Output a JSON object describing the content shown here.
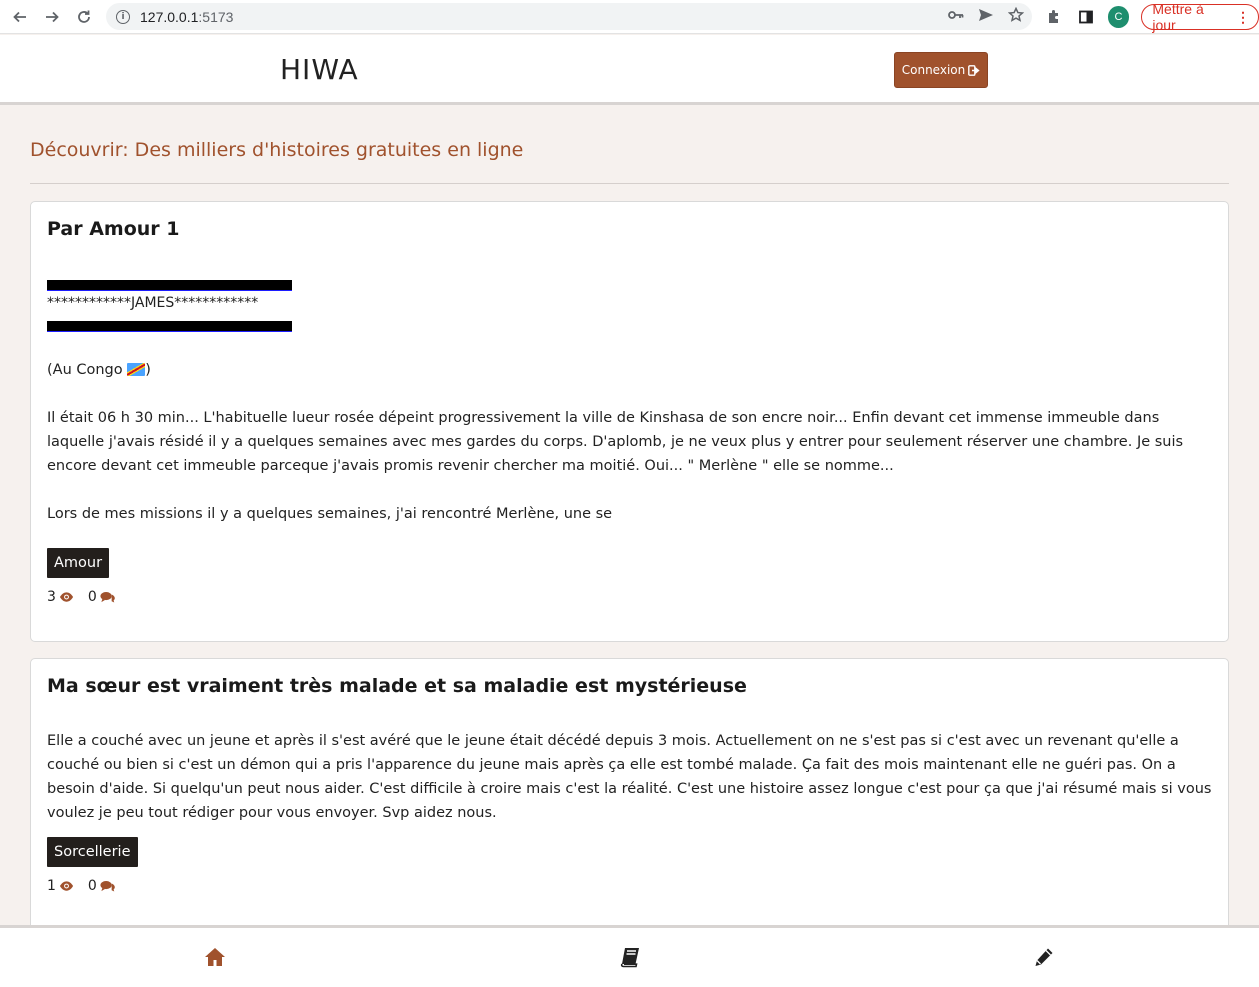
{
  "browser": {
    "url_host": "127.0.0.1",
    "url_port": ":5173",
    "profile_initial": "C",
    "update_label": "Mettre à jour"
  },
  "header": {
    "brand": "HIWA",
    "login_label": "Connexion"
  },
  "main": {
    "heading": "Découvrir: Des milliers d'histoires gratuites en ligne"
  },
  "stories": [
    {
      "title": "Par Amour 1",
      "stars_line": "************JAMES************",
      "location": "(Au Congo",
      "location_close": ")",
      "paragraph1": "Il était 06 h 30 min... L'habituelle lueur rosée dépeint progressivement la ville de Kinshasa de son encre noir... Enfin devant cet immense immeuble dans laquelle j'avais résidé il y a quelques semaines avec mes gardes du corps. D'aplomb, je ne veux plus y entrer pour seulement réserver une chambre. Je suis encore devant cet immeuble parceque j'avais promis revenir chercher ma moitié. Oui... \" Merlène \" elle se nomme...",
      "paragraph2": "Lors de mes missions il y a quelques semaines, j'ai rencontré Merlène, une se",
      "tag": "Amour",
      "views": "3",
      "comments": "0"
    },
    {
      "title": "Ma sœur est vraiment très malade et sa maladie est mystérieuse",
      "paragraph1": "Elle a couché avec un jeune et après il s'est avéré que le jeune était décédé depuis 3 mois. Actuellement on ne s'est pas si c'est avec un revenant qu'elle a couché ou bien si c'est un démon qui a pris l'apparence du jeune mais après ça elle est tombé malade. Ça fait des mois maintenant elle ne guéri pas. On a besoin d'aide. Si quelqu'un peut nous aider. C'est difficile à croire mais c'est la réalité. C'est une histoire assez longue c'est pour ça que j'ai résumé mais si vous voulez je peu tout rédiger pour vous envoyer. Svp aidez nous.",
      "tag": "Sorcellerie",
      "views": "1",
      "comments": "0"
    }
  ],
  "colors": {
    "accent": "#a0522d",
    "tag_bg": "#231f1c",
    "page_bg": "#f6f1ee"
  },
  "icons": {
    "views": "eye-icon",
    "comments": "comments-icon",
    "nav_home": "home-icon",
    "nav_stories": "book-icon",
    "nav_write": "pencil-icon"
  }
}
